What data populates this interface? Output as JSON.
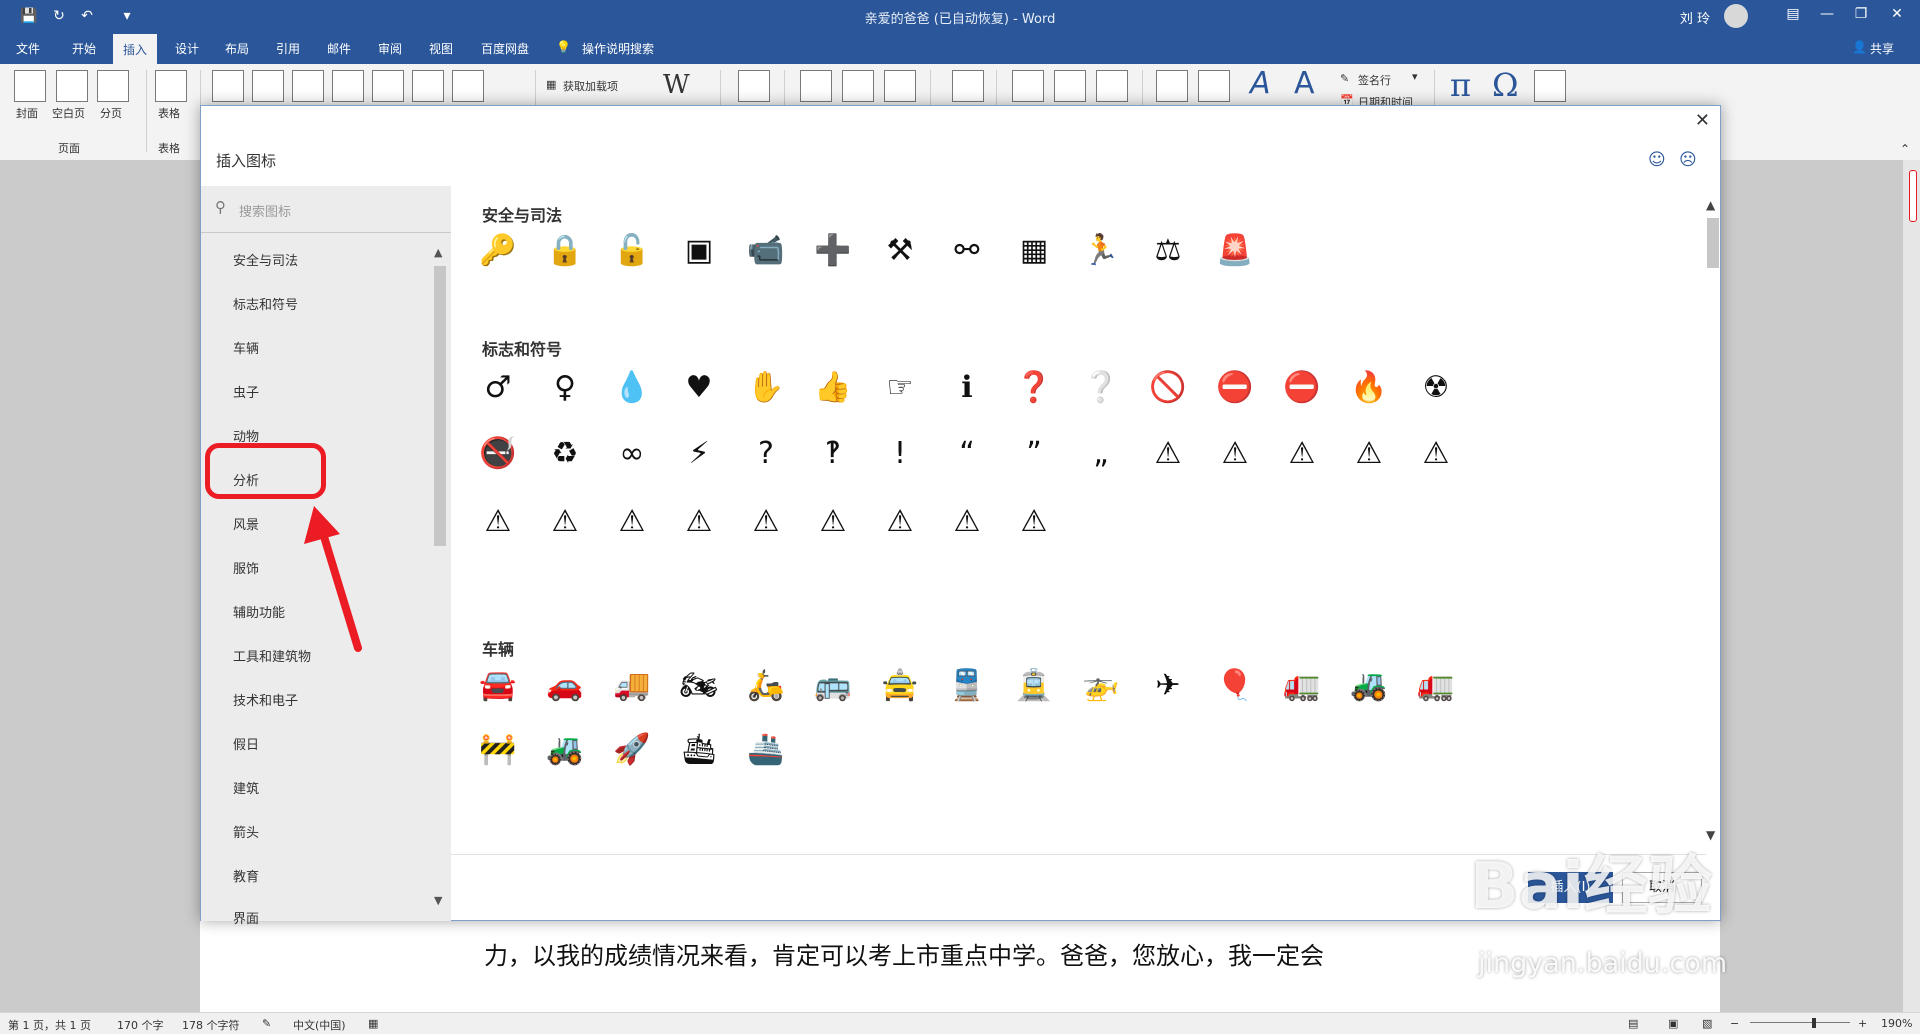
{
  "window": {
    "title": "亲爱的爸爸 (已自动恢复)  -  Word",
    "user": "刘 玲",
    "share_label": "共享"
  },
  "menu": {
    "tabs": [
      "文件",
      "开始",
      "插入",
      "设计",
      "布局",
      "引用",
      "邮件",
      "审阅",
      "视图",
      "百度网盘"
    ],
    "active_tab": "插入",
    "tell_me": "操作说明搜索"
  },
  "ribbon": {
    "cover_label": "封面",
    "blank_label": "空白页",
    "break_label": "分页",
    "pages_group": "页面",
    "table_label": "表格",
    "tables_group": "表格",
    "addins_label": "获取加载项",
    "signature_label": "签名行",
    "datetime_label": "日期和时间"
  },
  "dialog": {
    "title": "插入图标",
    "search_placeholder": "搜索图标",
    "categories": [
      "安全与司法",
      "标志和符号",
      "车辆",
      "虫子",
      "动物",
      "分析",
      "风景",
      "服饰",
      "辅助功能",
      "工具和建筑物",
      "技术和电子",
      "假日",
      "建筑",
      "箭头",
      "教育",
      "界面"
    ],
    "selected_category": "分析",
    "sections": [
      "安全与司法",
      "标志和符号",
      "车辆"
    ],
    "insert_label": "插入(I)",
    "cancel_label": "取消"
  },
  "icons": {
    "safety": [
      "key-icon",
      "lock-closed-icon",
      "lock-open-icon",
      "safe-icon",
      "security-camera-icon",
      "street-lamp-icon",
      "gavel-icon",
      "handcuffs-icon",
      "jail-bars-icon",
      "running-thief-icon",
      "scales-icon",
      "police-light-icon"
    ],
    "signs_row1": [
      "male-icon",
      "female-icon",
      "water-drop-icon",
      "heart-icon",
      "hand-stop-icon",
      "thumbs-up-icon",
      "pointing-hand-icon",
      "info-icon",
      "question-circle-icon",
      "question-hook-circle-icon",
      "no-sign-icon",
      "stop-octagon-icon",
      "no-entry-icon",
      "fire-icon",
      "radiation-icon"
    ],
    "signs_row2": [
      "no-smoking-icon",
      "recycle-icon",
      "infinity-icon",
      "lightning-icon",
      "question-mark-icon",
      "question-hook-icon",
      "exclamation-icon",
      "quote-open-icon",
      "quote-close-icon",
      "quote-pair-icon",
      "warning-electric-icon",
      "warning-exclamation-icon",
      "warning-x-icon",
      "warning-no-fire-icon",
      "warning-radiation-icon"
    ],
    "signs_row3": [
      "warning-fire-icon",
      "warning-explosion-icon",
      "warning-biohazard-icon",
      "warning-skull-icon",
      "warning-camera-icon",
      "warning-landslide-icon",
      "warning-drowning-icon",
      "warning-cold-icon",
      "warning-temperature-icon"
    ],
    "vehicles_row1": [
      "car-icon",
      "electric-car-icon",
      "truck-icon",
      "motorcycle-icon",
      "scooter-icon",
      "bus-icon",
      "taxi-icon",
      "train-icon",
      "tram-icon",
      "helicopter-icon",
      "airplane-icon",
      "hot-air-balloon-icon",
      "delivery-truck-icon",
      "snowplow-icon",
      "cement-mixer-icon"
    ],
    "vehicles_row2": [
      "excavator-icon",
      "tractor-icon",
      "rocket-icon",
      "cruise-ship-icon",
      "ship-icon"
    ]
  },
  "document": {
    "body_text": "力，以我的成绩情况来看，肯定可以考上市重点中学。爸爸，您放心，我一定会"
  },
  "status": {
    "page": "第 1 页，共 1 页",
    "words": "170 个字",
    "chars": "178 个字符",
    "language": "中文(中国)",
    "zoom": "190%"
  },
  "watermark": {
    "brand": "Bai经验",
    "url": "jingyan.baidu.com"
  }
}
